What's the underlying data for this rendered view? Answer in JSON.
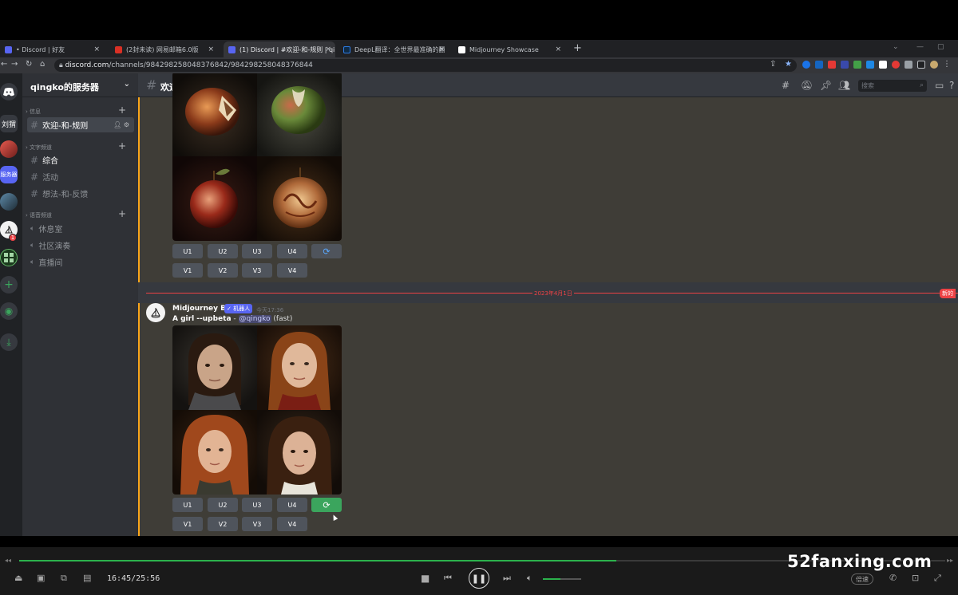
{
  "browser": {
    "tabs": [
      {
        "title": "• Discord | 好友",
        "fav": "#5865f2",
        "active": false
      },
      {
        "title": "(2封未读) 网易邮箱6.0版",
        "fav": "#d93025",
        "active": false
      },
      {
        "title": "(1) Discord | #欢迎-和-规则 | qi",
        "fav": "#5865f2",
        "active": true
      },
      {
        "title": "DeepL翻译：全世界最准确的翻",
        "fav": "#0f2b46",
        "active": false
      },
      {
        "title": "Midjourney Showcase",
        "fav": "#ffffff",
        "active": false
      }
    ],
    "tab_close": "×",
    "new_tab": "+",
    "url_host": "discord.com",
    "url_path": "/channels/984298258048376842/984298258048376844"
  },
  "server": {
    "name": "qingko的服务器",
    "categories": [
      {
        "label": "信息"
      },
      {
        "label": "文字频道"
      },
      {
        "label": "语音频道"
      }
    ],
    "channels": [
      {
        "label": "欢迎-和-规则",
        "type": "text"
      },
      {
        "label": "综合",
        "type": "text"
      },
      {
        "label": "活动",
        "type": "text"
      },
      {
        "label": "想法-和-反馈",
        "type": "text"
      },
      {
        "label": "休息室",
        "type": "voice"
      },
      {
        "label": "社区演奏",
        "type": "voice"
      },
      {
        "label": "直播间",
        "type": "voice"
      }
    ]
  },
  "guilds": [
    {
      "label": "刘猬",
      "color": "#36393f"
    },
    {
      "label": "",
      "color": "#b9332b"
    },
    {
      "label": "服务器",
      "color": "#5865f2"
    },
    {
      "label": "",
      "color": "#3a6e8f"
    },
    {
      "label": "",
      "color": "#f2f2f2",
      "badge": "1"
    },
    {
      "label": "",
      "color": "#2e7d32"
    }
  ],
  "header": {
    "channel_name": "欢迎-和-规则",
    "search_placeholder": "搜索"
  },
  "messages": {
    "upscale_buttons": [
      "U1",
      "U2",
      "U3",
      "U4"
    ],
    "variation_buttons": [
      "V1",
      "V2",
      "V3",
      "V4"
    ],
    "divider_date": "2023年4月1日",
    "new_tag": "新的",
    "author": "Midjourney Bot",
    "bot_tag": "✓ 机器人",
    "timestamp": "今天17:36",
    "prompt_bold": "A girl --upbeta",
    "prompt_sep": " - ",
    "prompt_mention": "@qingko",
    "prompt_suffix": " (fast)"
  },
  "player": {
    "time": "16:45/25:56",
    "progress": 0.645,
    "volume": 0.45,
    "speed_label": "倍速"
  },
  "watermark": "52fanxing.com"
}
